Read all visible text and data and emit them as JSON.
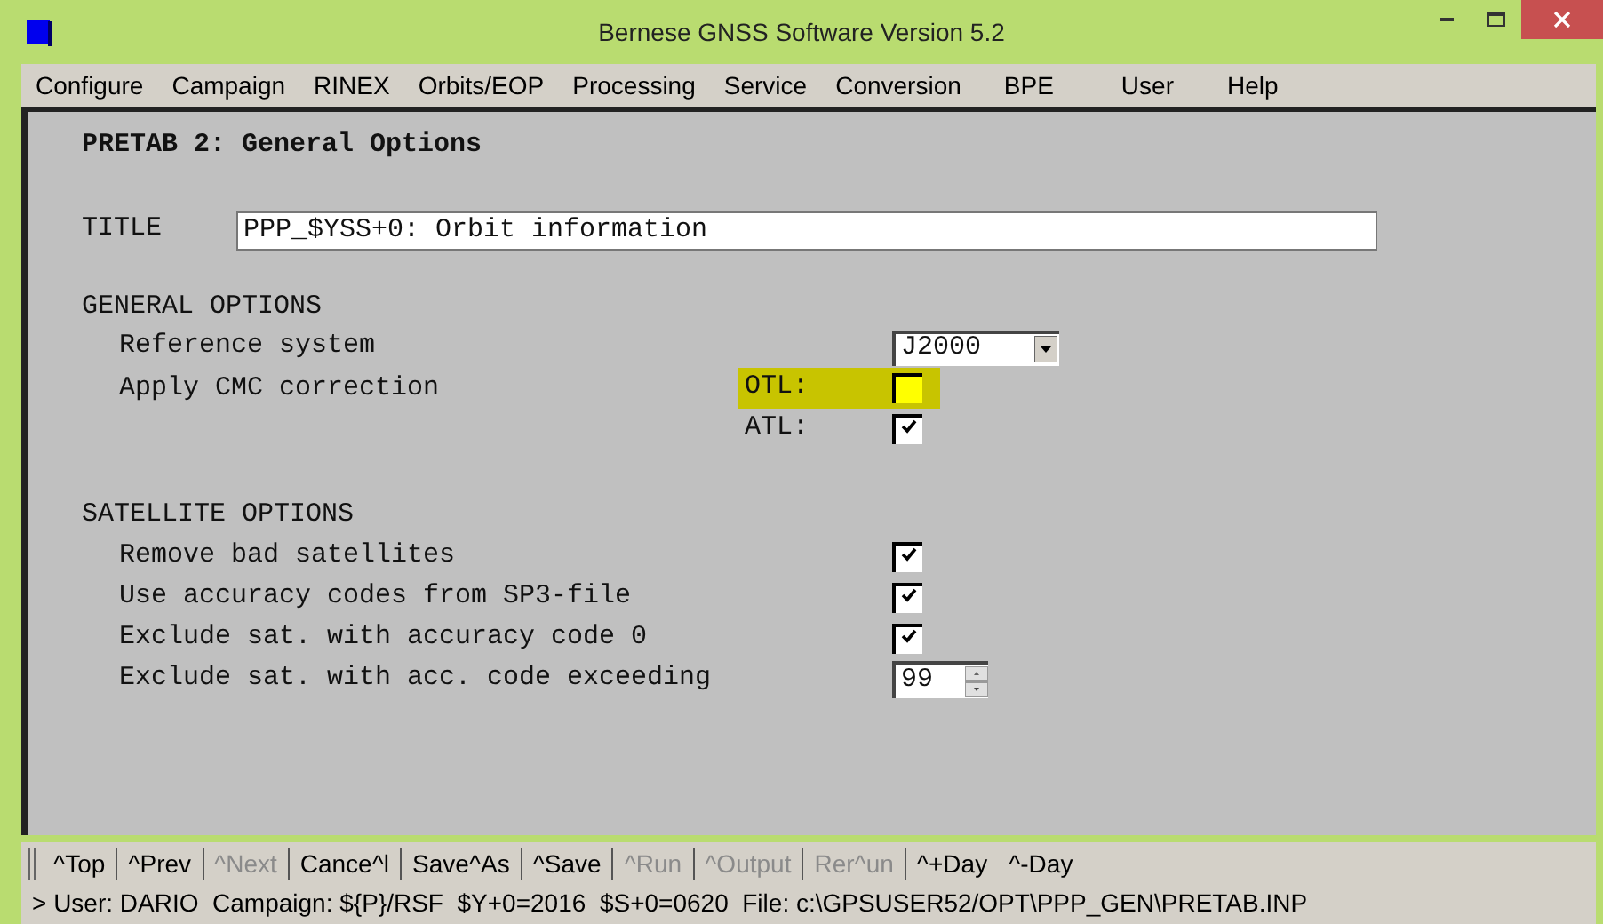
{
  "window": {
    "title": "Bernese GNSS Software Version 5.2"
  },
  "menu": [
    "Configure",
    "Campaign",
    "RINEX",
    "Orbits/EOP",
    "Processing",
    "Service",
    "Conversion",
    "BPE",
    "User",
    "Help"
  ],
  "panel": {
    "heading": "PRETAB 2: General Options",
    "title_label": "TITLE",
    "title_value": "PPP_$YSS+0: Orbit information",
    "sections": [
      {
        "heading": "GENERAL OPTIONS",
        "rows": [
          {
            "kind": "select",
            "label": "Reference system",
            "value": "J2000"
          },
          {
            "kind": "options",
            "label": "Apply CMC correction",
            "options": [
              {
                "label": "OTL:",
                "checked": false,
                "highlighted": true
              },
              {
                "label": "ATL:",
                "checked": true,
                "highlighted": false
              }
            ]
          }
        ]
      },
      {
        "heading": "SATELLITE OPTIONS",
        "rows": [
          {
            "kind": "check",
            "label": "Remove bad satellites",
            "checked": true
          },
          {
            "kind": "check",
            "label": "Use accuracy codes from SP3-file",
            "checked": true
          },
          {
            "kind": "check",
            "label": "Exclude sat. with accuracy code 0",
            "checked": true
          },
          {
            "kind": "spin",
            "label": "Exclude sat. with acc. code exceeding",
            "value": "99"
          }
        ]
      }
    ]
  },
  "buttons": [
    {
      "label": "^Top",
      "disabled": false
    },
    {
      "label": "^Prev",
      "disabled": false
    },
    {
      "label": "^Next",
      "disabled": true
    },
    {
      "label": "Cance^l",
      "disabled": false
    },
    {
      "label": "Save^As",
      "disabled": false
    },
    {
      "label": "^Save",
      "disabled": false
    },
    {
      "label": "^Run",
      "disabled": true
    },
    {
      "label": "^Output",
      "disabled": true
    },
    {
      "label": "Rer^un",
      "disabled": true
    },
    {
      "label": "^+Day",
      "disabled": false
    },
    {
      "label": "^-Day",
      "disabled": false
    }
  ],
  "status": "> User: DARIO  Campaign: ${P}/RSF  $Y+0=2016  $S+0=0620  File: c:\\GPSUSER52/OPT\\PPP_GEN\\PRETAB.INP"
}
